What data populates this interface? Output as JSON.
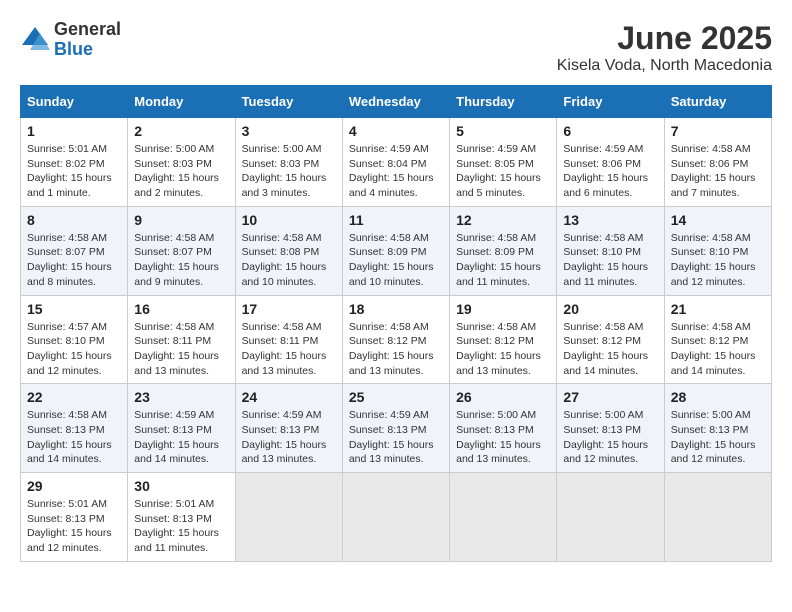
{
  "logo": {
    "general": "General",
    "blue": "Blue"
  },
  "title": "June 2025",
  "subtitle": "Kisela Voda, North Macedonia",
  "headers": [
    "Sunday",
    "Monday",
    "Tuesday",
    "Wednesday",
    "Thursday",
    "Friday",
    "Saturday"
  ],
  "weeks": [
    [
      {
        "day": "1",
        "sunrise": "5:01 AM",
        "sunset": "8:02 PM",
        "daylight": "15 hours and 1 minute."
      },
      {
        "day": "2",
        "sunrise": "5:00 AM",
        "sunset": "8:03 PM",
        "daylight": "15 hours and 2 minutes."
      },
      {
        "day": "3",
        "sunrise": "5:00 AM",
        "sunset": "8:03 PM",
        "daylight": "15 hours and 3 minutes."
      },
      {
        "day": "4",
        "sunrise": "4:59 AM",
        "sunset": "8:04 PM",
        "daylight": "15 hours and 4 minutes."
      },
      {
        "day": "5",
        "sunrise": "4:59 AM",
        "sunset": "8:05 PM",
        "daylight": "15 hours and 5 minutes."
      },
      {
        "day": "6",
        "sunrise": "4:59 AM",
        "sunset": "8:06 PM",
        "daylight": "15 hours and 6 minutes."
      },
      {
        "day": "7",
        "sunrise": "4:58 AM",
        "sunset": "8:06 PM",
        "daylight": "15 hours and 7 minutes."
      }
    ],
    [
      {
        "day": "8",
        "sunrise": "4:58 AM",
        "sunset": "8:07 PM",
        "daylight": "15 hours and 8 minutes."
      },
      {
        "day": "9",
        "sunrise": "4:58 AM",
        "sunset": "8:07 PM",
        "daylight": "15 hours and 9 minutes."
      },
      {
        "day": "10",
        "sunrise": "4:58 AM",
        "sunset": "8:08 PM",
        "daylight": "15 hours and 10 minutes."
      },
      {
        "day": "11",
        "sunrise": "4:58 AM",
        "sunset": "8:09 PM",
        "daylight": "15 hours and 10 minutes."
      },
      {
        "day": "12",
        "sunrise": "4:58 AM",
        "sunset": "8:09 PM",
        "daylight": "15 hours and 11 minutes."
      },
      {
        "day": "13",
        "sunrise": "4:58 AM",
        "sunset": "8:10 PM",
        "daylight": "15 hours and 11 minutes."
      },
      {
        "day": "14",
        "sunrise": "4:58 AM",
        "sunset": "8:10 PM",
        "daylight": "15 hours and 12 minutes."
      }
    ],
    [
      {
        "day": "15",
        "sunrise": "4:57 AM",
        "sunset": "8:10 PM",
        "daylight": "15 hours and 12 minutes."
      },
      {
        "day": "16",
        "sunrise": "4:58 AM",
        "sunset": "8:11 PM",
        "daylight": "15 hours and 13 minutes."
      },
      {
        "day": "17",
        "sunrise": "4:58 AM",
        "sunset": "8:11 PM",
        "daylight": "15 hours and 13 minutes."
      },
      {
        "day": "18",
        "sunrise": "4:58 AM",
        "sunset": "8:12 PM",
        "daylight": "15 hours and 13 minutes."
      },
      {
        "day": "19",
        "sunrise": "4:58 AM",
        "sunset": "8:12 PM",
        "daylight": "15 hours and 13 minutes."
      },
      {
        "day": "20",
        "sunrise": "4:58 AM",
        "sunset": "8:12 PM",
        "daylight": "15 hours and 14 minutes."
      },
      {
        "day": "21",
        "sunrise": "4:58 AM",
        "sunset": "8:12 PM",
        "daylight": "15 hours and 14 minutes."
      }
    ],
    [
      {
        "day": "22",
        "sunrise": "4:58 AM",
        "sunset": "8:13 PM",
        "daylight": "15 hours and 14 minutes."
      },
      {
        "day": "23",
        "sunrise": "4:59 AM",
        "sunset": "8:13 PM",
        "daylight": "15 hours and 14 minutes."
      },
      {
        "day": "24",
        "sunrise": "4:59 AM",
        "sunset": "8:13 PM",
        "daylight": "15 hours and 13 minutes."
      },
      {
        "day": "25",
        "sunrise": "4:59 AM",
        "sunset": "8:13 PM",
        "daylight": "15 hours and 13 minutes."
      },
      {
        "day": "26",
        "sunrise": "5:00 AM",
        "sunset": "8:13 PM",
        "daylight": "15 hours and 13 minutes."
      },
      {
        "day": "27",
        "sunrise": "5:00 AM",
        "sunset": "8:13 PM",
        "daylight": "15 hours and 12 minutes."
      },
      {
        "day": "28",
        "sunrise": "5:00 AM",
        "sunset": "8:13 PM",
        "daylight": "15 hours and 12 minutes."
      }
    ],
    [
      {
        "day": "29",
        "sunrise": "5:01 AM",
        "sunset": "8:13 PM",
        "daylight": "15 hours and 12 minutes."
      },
      {
        "day": "30",
        "sunrise": "5:01 AM",
        "sunset": "8:13 PM",
        "daylight": "15 hours and 11 minutes."
      },
      null,
      null,
      null,
      null,
      null
    ]
  ],
  "labels": {
    "sunrise": "Sunrise:",
    "sunset": "Sunset:",
    "daylight": "Daylight:"
  }
}
